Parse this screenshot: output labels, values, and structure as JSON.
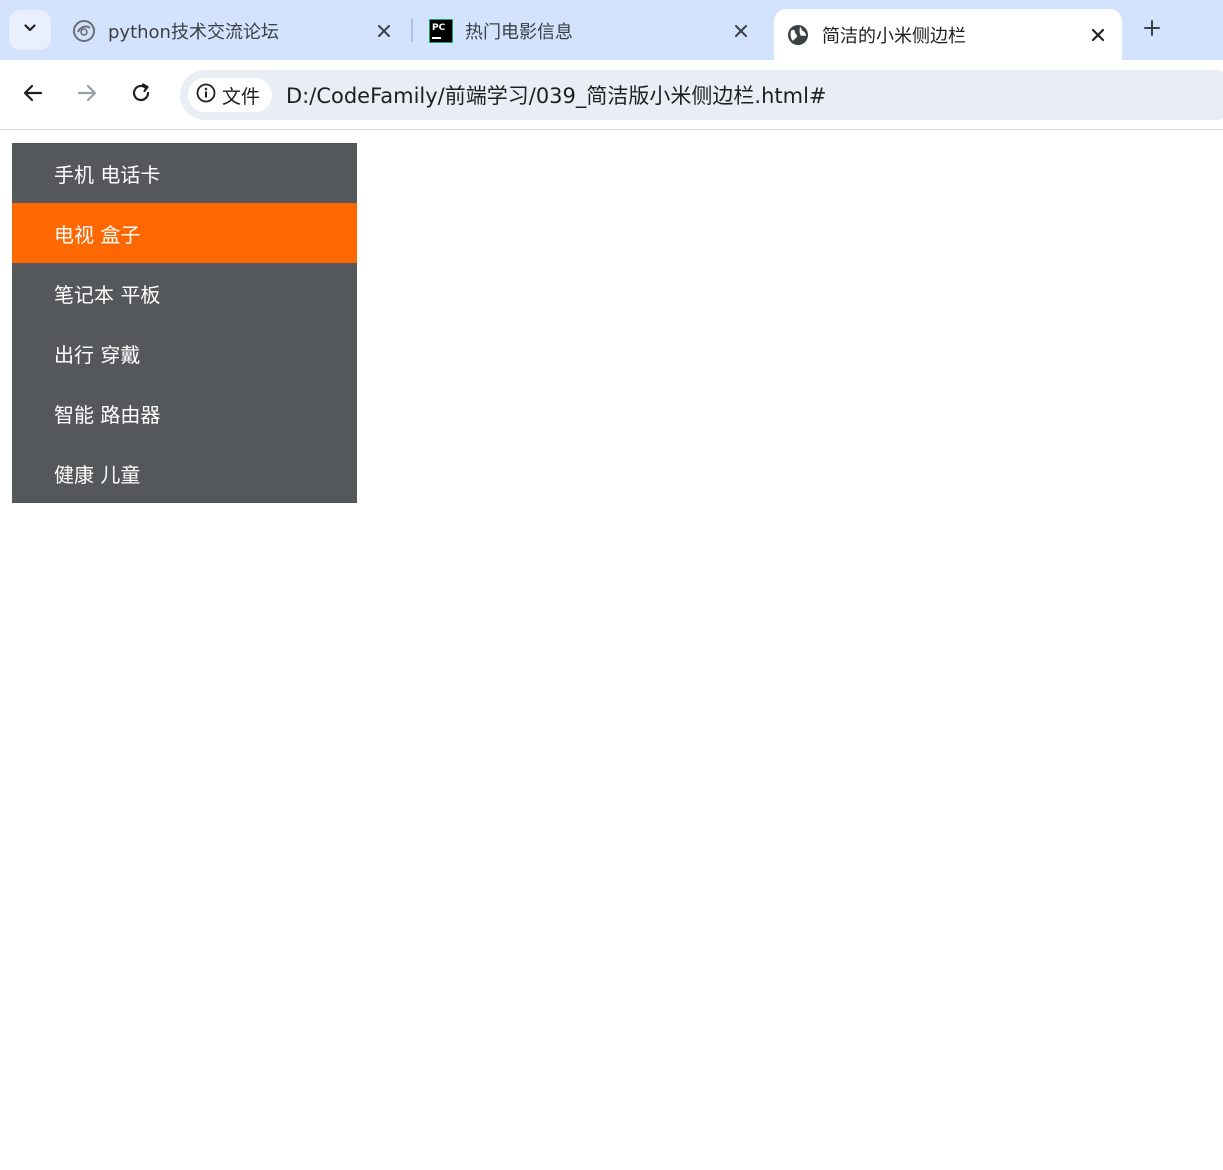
{
  "browser": {
    "tabs": [
      {
        "title": "python技术交流论坛",
        "icon": "forum-site-icon",
        "active": false
      },
      {
        "title": "热门电影信息",
        "icon": "pycharm-icon",
        "active": false
      },
      {
        "title": "简洁的小米侧边栏",
        "icon": "globe-icon",
        "active": true
      }
    ],
    "omnibox": {
      "security_chip_label": "文件",
      "url": "D:/CodeFamily/前端学习/039_简洁版小米侧边栏.html#"
    }
  },
  "sidebar": {
    "items": [
      {
        "label": "手机 电话卡",
        "active": false
      },
      {
        "label": "电视 盒子",
        "active": true
      },
      {
        "label": "笔记本 平板",
        "active": false
      },
      {
        "label": "出行 穿戴",
        "active": false
      },
      {
        "label": "智能 路由器",
        "active": false
      },
      {
        "label": "健康 儿童",
        "active": false
      }
    ]
  },
  "colors": {
    "sidebar_bg": "#55585a",
    "active_bg": "#ff6700",
    "tabstrip_bg": "#d3e3fd",
    "text_white": "#ffffff"
  }
}
